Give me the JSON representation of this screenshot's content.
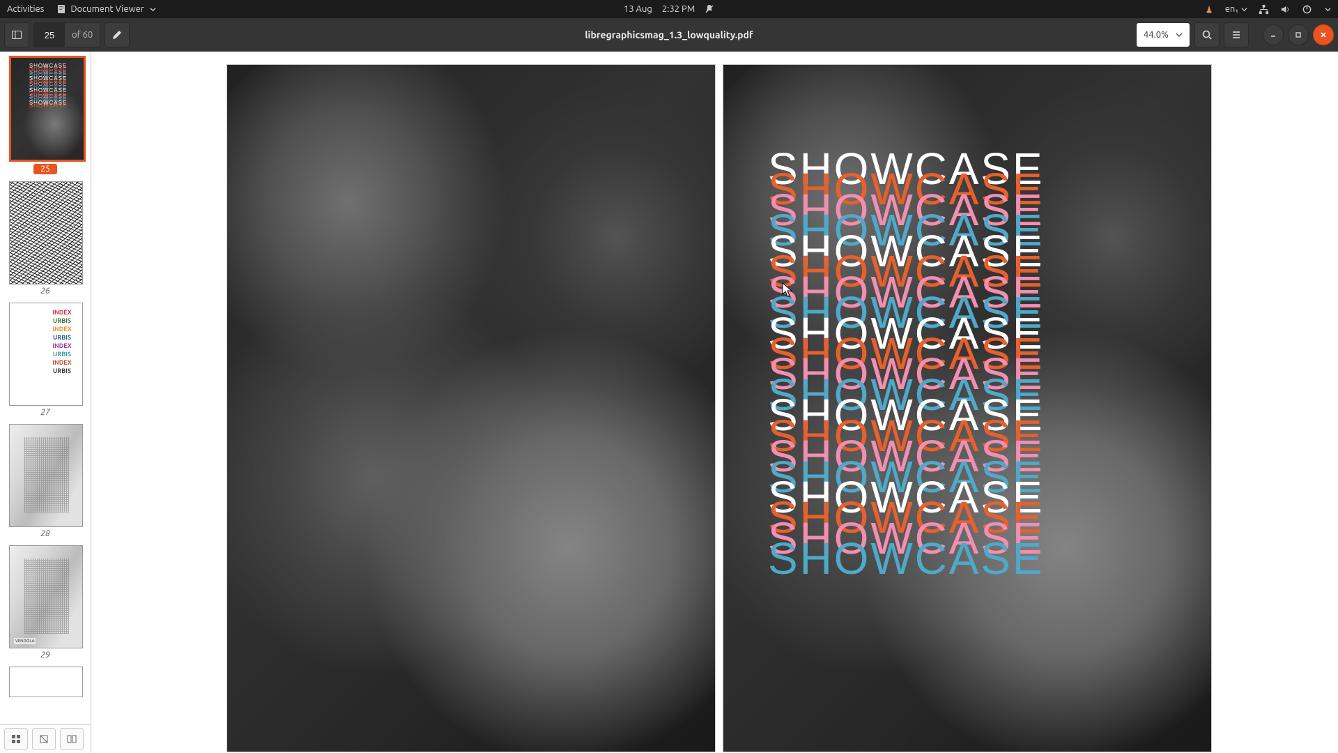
{
  "topbar": {
    "activities": "Activities",
    "app_name": "Document Viewer",
    "date": "13 Aug",
    "time": "2:32 PM",
    "input_source": "en₁"
  },
  "header": {
    "filename": "libregraphicsmag_1.3_lowquality.pdf",
    "page_current": "25",
    "page_total": "of 60",
    "zoom": "44.0%"
  },
  "sidebar": {
    "thumbs": [
      {
        "num": "25",
        "selected": true
      },
      {
        "num": "26",
        "selected": false
      },
      {
        "num": "27",
        "selected": false
      },
      {
        "num": "28",
        "selected": false
      },
      {
        "num": "29",
        "selected": false
      }
    ]
  },
  "page_content": {
    "showcase_word": "SHOWCASE",
    "showcase_rows": 20,
    "colors": {
      "white": "#ffffff",
      "orange": "#e8602c",
      "pink": "#f28fb1",
      "teal": "#4fa9c9"
    }
  },
  "thumb27": {
    "words": [
      "INDEX",
      "URBIS",
      "INDEX",
      "URBIS",
      "INDEX",
      "URBIS",
      "INDEX",
      "URBIS"
    ],
    "word_colors": [
      "#d03050",
      "#3a7a3a",
      "#e89030",
      "#2a5a9a",
      "#9a3a9a",
      "#3a9a9a",
      "#c05030",
      "#3a3a3a"
    ]
  },
  "thumb29": {
    "caption": "VENDOLA"
  }
}
